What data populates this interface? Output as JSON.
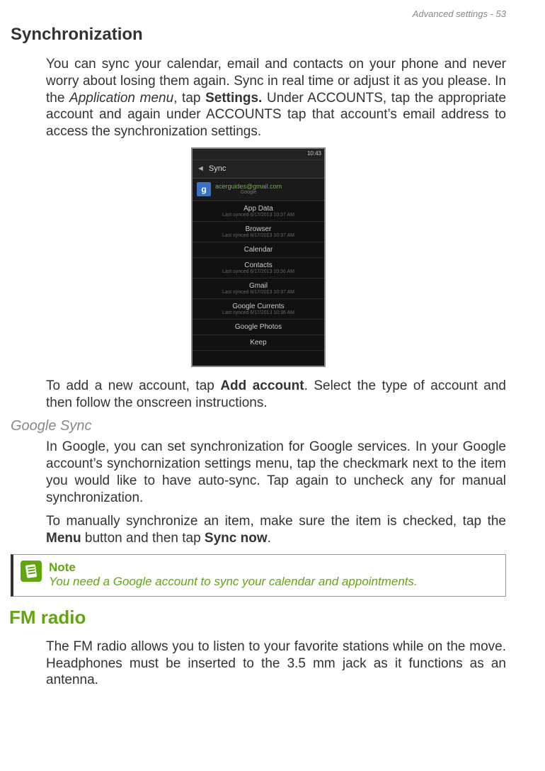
{
  "header": {
    "text": "Advanced settings - 53"
  },
  "section1": {
    "title": "Synchronization",
    "para1_a": "You can sync your calendar, email and contacts on your phone and never worry about losing them again. Sync in real time or adjust it as you please. In the ",
    "para1_italic": "Application menu",
    "para1_b": ", tap ",
    "para1_bold": "Settings.",
    "para1_c": " Under ACCOUNTS, tap the appropriate account and again under ACCOUNTS tap that account’s email address to access the synchronization settings.",
    "para2_a": "To add a new account, tap ",
    "para2_bold": "Add account",
    "para2_b": ". Select the type of account and then follow the onscreen instructions."
  },
  "screenshot": {
    "time": "10:43",
    "sync_label": "Sync",
    "account_email": "acerguides@gmail.com",
    "account_provider": "Google",
    "items": [
      {
        "name": "App Data",
        "meta": "Last synced 6/17/2013 10:37 AM"
      },
      {
        "name": "Browser",
        "meta": "Last synced 6/17/2013 10:37 AM"
      },
      {
        "name": "Calendar",
        "meta": ""
      },
      {
        "name": "Contacts",
        "meta": "Last synced 6/17/2013 10:36 AM"
      },
      {
        "name": "Gmail",
        "meta": "Last synced 6/17/2013 10:37 AM"
      },
      {
        "name": "Google Currents",
        "meta": "Last synced 6/17/2013 10:36 AM"
      },
      {
        "name": "Google Photos",
        "meta": ""
      },
      {
        "name": "Keep",
        "meta": ""
      }
    ]
  },
  "subsection": {
    "title": "Google Sync",
    "para1": "In Google, you can set synchronization for Google services. In your Google account’s synchornization settings menu, tap the checkmark next to the item you would like to have auto-sync. Tap again to uncheck any for manual synchronization.",
    "para2_a": "To manually synchronize an item, make sure the item is checked, tap the ",
    "para2_bold1": "Menu",
    "para2_b": " button and then tap ",
    "para2_bold2": "Sync now",
    "para2_c": "."
  },
  "note": {
    "label": "Note",
    "text": "You need a Google account to sync your calendar and appointments."
  },
  "section2": {
    "title": "FM radio",
    "para": "The FM radio allows you to listen to your favorite stations while on the move. Headphones must be inserted to the 3.5 mm jack as it functions as an antenna."
  }
}
